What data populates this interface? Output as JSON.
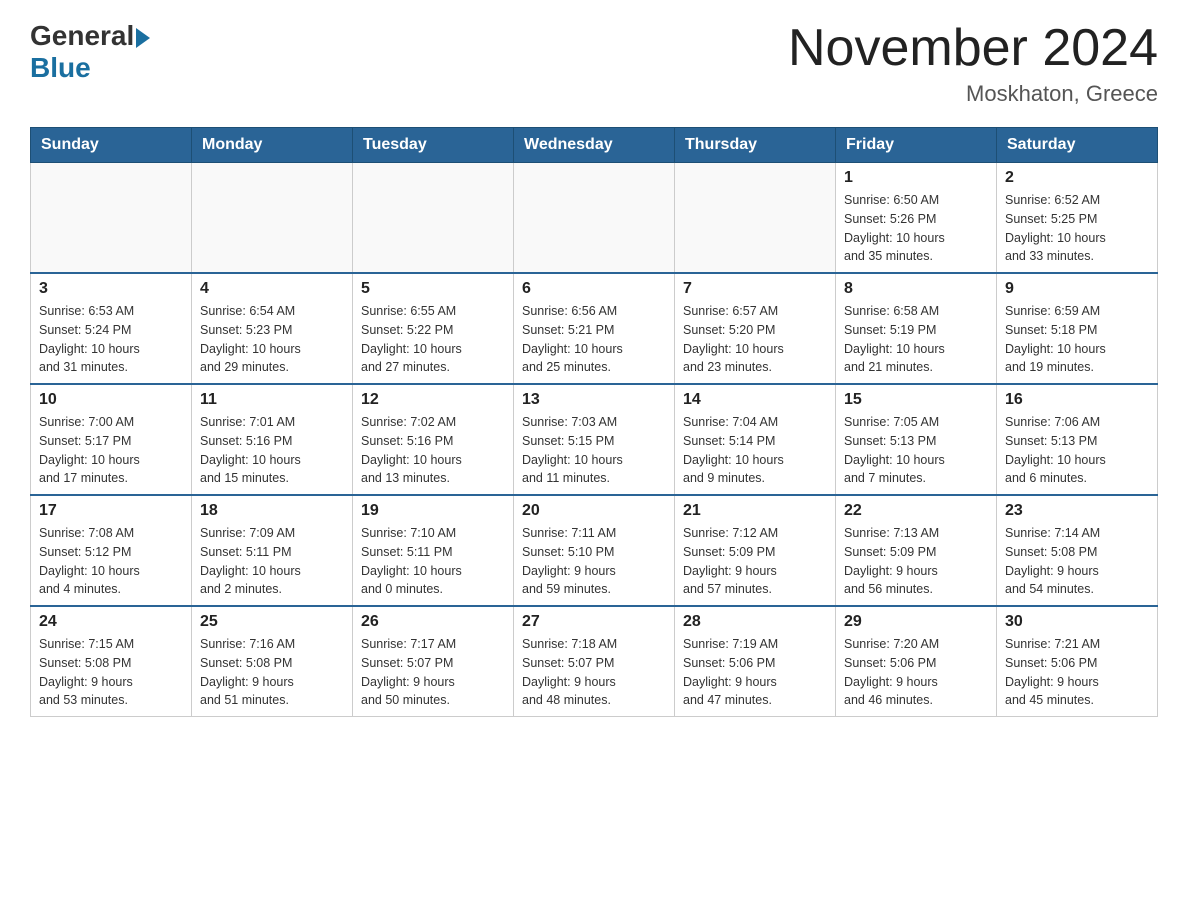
{
  "logo": {
    "general": "General",
    "blue": "Blue"
  },
  "title": "November 2024",
  "location": "Moskhaton, Greece",
  "weekdays": [
    "Sunday",
    "Monday",
    "Tuesday",
    "Wednesday",
    "Thursday",
    "Friday",
    "Saturday"
  ],
  "weeks": [
    [
      {
        "day": "",
        "info": ""
      },
      {
        "day": "",
        "info": ""
      },
      {
        "day": "",
        "info": ""
      },
      {
        "day": "",
        "info": ""
      },
      {
        "day": "",
        "info": ""
      },
      {
        "day": "1",
        "info": "Sunrise: 6:50 AM\nSunset: 5:26 PM\nDaylight: 10 hours\nand 35 minutes."
      },
      {
        "day": "2",
        "info": "Sunrise: 6:52 AM\nSunset: 5:25 PM\nDaylight: 10 hours\nand 33 minutes."
      }
    ],
    [
      {
        "day": "3",
        "info": "Sunrise: 6:53 AM\nSunset: 5:24 PM\nDaylight: 10 hours\nand 31 minutes."
      },
      {
        "day": "4",
        "info": "Sunrise: 6:54 AM\nSunset: 5:23 PM\nDaylight: 10 hours\nand 29 minutes."
      },
      {
        "day": "5",
        "info": "Sunrise: 6:55 AM\nSunset: 5:22 PM\nDaylight: 10 hours\nand 27 minutes."
      },
      {
        "day": "6",
        "info": "Sunrise: 6:56 AM\nSunset: 5:21 PM\nDaylight: 10 hours\nand 25 minutes."
      },
      {
        "day": "7",
        "info": "Sunrise: 6:57 AM\nSunset: 5:20 PM\nDaylight: 10 hours\nand 23 minutes."
      },
      {
        "day": "8",
        "info": "Sunrise: 6:58 AM\nSunset: 5:19 PM\nDaylight: 10 hours\nand 21 minutes."
      },
      {
        "day": "9",
        "info": "Sunrise: 6:59 AM\nSunset: 5:18 PM\nDaylight: 10 hours\nand 19 minutes."
      }
    ],
    [
      {
        "day": "10",
        "info": "Sunrise: 7:00 AM\nSunset: 5:17 PM\nDaylight: 10 hours\nand 17 minutes."
      },
      {
        "day": "11",
        "info": "Sunrise: 7:01 AM\nSunset: 5:16 PM\nDaylight: 10 hours\nand 15 minutes."
      },
      {
        "day": "12",
        "info": "Sunrise: 7:02 AM\nSunset: 5:16 PM\nDaylight: 10 hours\nand 13 minutes."
      },
      {
        "day": "13",
        "info": "Sunrise: 7:03 AM\nSunset: 5:15 PM\nDaylight: 10 hours\nand 11 minutes."
      },
      {
        "day": "14",
        "info": "Sunrise: 7:04 AM\nSunset: 5:14 PM\nDaylight: 10 hours\nand 9 minutes."
      },
      {
        "day": "15",
        "info": "Sunrise: 7:05 AM\nSunset: 5:13 PM\nDaylight: 10 hours\nand 7 minutes."
      },
      {
        "day": "16",
        "info": "Sunrise: 7:06 AM\nSunset: 5:13 PM\nDaylight: 10 hours\nand 6 minutes."
      }
    ],
    [
      {
        "day": "17",
        "info": "Sunrise: 7:08 AM\nSunset: 5:12 PM\nDaylight: 10 hours\nand 4 minutes."
      },
      {
        "day": "18",
        "info": "Sunrise: 7:09 AM\nSunset: 5:11 PM\nDaylight: 10 hours\nand 2 minutes."
      },
      {
        "day": "19",
        "info": "Sunrise: 7:10 AM\nSunset: 5:11 PM\nDaylight: 10 hours\nand 0 minutes."
      },
      {
        "day": "20",
        "info": "Sunrise: 7:11 AM\nSunset: 5:10 PM\nDaylight: 9 hours\nand 59 minutes."
      },
      {
        "day": "21",
        "info": "Sunrise: 7:12 AM\nSunset: 5:09 PM\nDaylight: 9 hours\nand 57 minutes."
      },
      {
        "day": "22",
        "info": "Sunrise: 7:13 AM\nSunset: 5:09 PM\nDaylight: 9 hours\nand 56 minutes."
      },
      {
        "day": "23",
        "info": "Sunrise: 7:14 AM\nSunset: 5:08 PM\nDaylight: 9 hours\nand 54 minutes."
      }
    ],
    [
      {
        "day": "24",
        "info": "Sunrise: 7:15 AM\nSunset: 5:08 PM\nDaylight: 9 hours\nand 53 minutes."
      },
      {
        "day": "25",
        "info": "Sunrise: 7:16 AM\nSunset: 5:08 PM\nDaylight: 9 hours\nand 51 minutes."
      },
      {
        "day": "26",
        "info": "Sunrise: 7:17 AM\nSunset: 5:07 PM\nDaylight: 9 hours\nand 50 minutes."
      },
      {
        "day": "27",
        "info": "Sunrise: 7:18 AM\nSunset: 5:07 PM\nDaylight: 9 hours\nand 48 minutes."
      },
      {
        "day": "28",
        "info": "Sunrise: 7:19 AM\nSunset: 5:06 PM\nDaylight: 9 hours\nand 47 minutes."
      },
      {
        "day": "29",
        "info": "Sunrise: 7:20 AM\nSunset: 5:06 PM\nDaylight: 9 hours\nand 46 minutes."
      },
      {
        "day": "30",
        "info": "Sunrise: 7:21 AM\nSunset: 5:06 PM\nDaylight: 9 hours\nand 45 minutes."
      }
    ]
  ]
}
